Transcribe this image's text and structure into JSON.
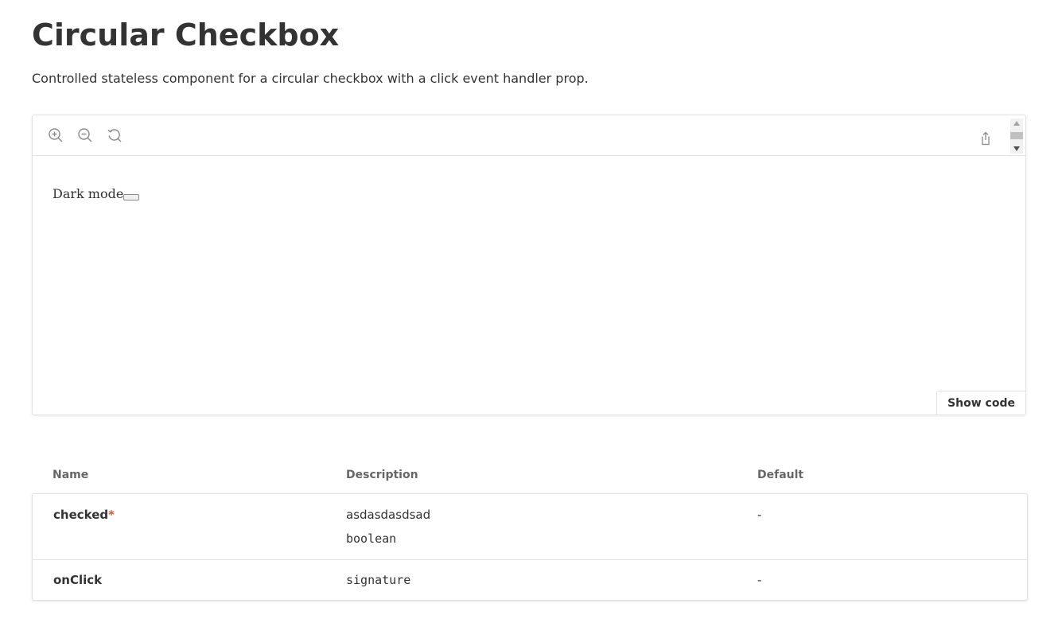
{
  "page": {
    "title": "Circular Checkbox",
    "description": "Controlled stateless component for a circular checkbox with a click event handler prop."
  },
  "preview": {
    "toolbar": {
      "zoom_in_icon": "zoom-in-icon",
      "zoom_out_icon": "zoom-out-icon",
      "reset_icon": "reset-zoom-icon",
      "share_icon": "share-icon"
    },
    "content": {
      "checkbox_label": "Dark mode",
      "checkbox_checked": false
    },
    "show_code_label": "Show code"
  },
  "props_table": {
    "headers": {
      "name": "Name",
      "description": "Description",
      "default": "Default"
    },
    "rows": [
      {
        "name": "checked",
        "required_marker": "*",
        "description": "asdasdasdsad",
        "type": "boolean",
        "default": "-"
      },
      {
        "name": "onClick",
        "description": "",
        "type": "signature",
        "default": "-"
      }
    ]
  },
  "colors": {
    "text": "#333333",
    "header_text": "#666666",
    "border": "#e2e2e2",
    "required": "#e05a2b",
    "icon": "#8a8a8a"
  }
}
